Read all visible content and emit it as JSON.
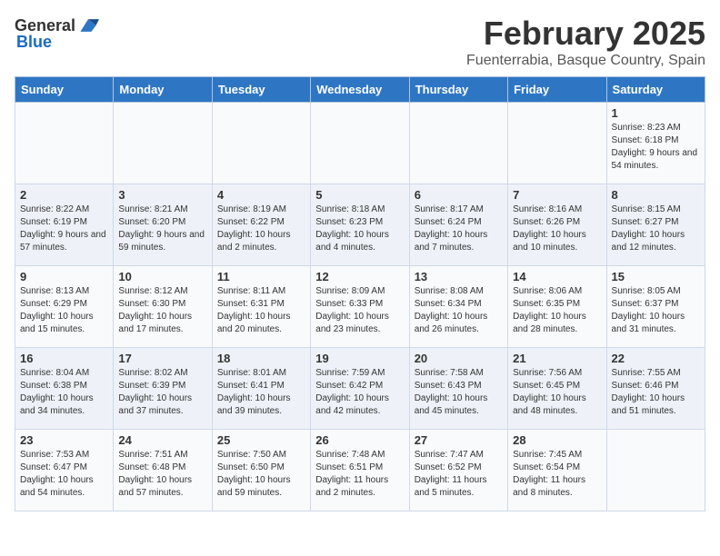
{
  "header": {
    "logo_general": "General",
    "logo_blue": "Blue",
    "title": "February 2025",
    "subtitle": "Fuenterrabia, Basque Country, Spain"
  },
  "calendar": {
    "days_of_week": [
      "Sunday",
      "Monday",
      "Tuesday",
      "Wednesday",
      "Thursday",
      "Friday",
      "Saturday"
    ],
    "weeks": [
      [
        {
          "day": "",
          "info": ""
        },
        {
          "day": "",
          "info": ""
        },
        {
          "day": "",
          "info": ""
        },
        {
          "day": "",
          "info": ""
        },
        {
          "day": "",
          "info": ""
        },
        {
          "day": "",
          "info": ""
        },
        {
          "day": "1",
          "info": "Sunrise: 8:23 AM\nSunset: 6:18 PM\nDaylight: 9 hours and 54 minutes."
        }
      ],
      [
        {
          "day": "2",
          "info": "Sunrise: 8:22 AM\nSunset: 6:19 PM\nDaylight: 9 hours and 57 minutes."
        },
        {
          "day": "3",
          "info": "Sunrise: 8:21 AM\nSunset: 6:20 PM\nDaylight: 9 hours and 59 minutes."
        },
        {
          "day": "4",
          "info": "Sunrise: 8:19 AM\nSunset: 6:22 PM\nDaylight: 10 hours and 2 minutes."
        },
        {
          "day": "5",
          "info": "Sunrise: 8:18 AM\nSunset: 6:23 PM\nDaylight: 10 hours and 4 minutes."
        },
        {
          "day": "6",
          "info": "Sunrise: 8:17 AM\nSunset: 6:24 PM\nDaylight: 10 hours and 7 minutes."
        },
        {
          "day": "7",
          "info": "Sunrise: 8:16 AM\nSunset: 6:26 PM\nDaylight: 10 hours and 10 minutes."
        },
        {
          "day": "8",
          "info": "Sunrise: 8:15 AM\nSunset: 6:27 PM\nDaylight: 10 hours and 12 minutes."
        }
      ],
      [
        {
          "day": "9",
          "info": "Sunrise: 8:13 AM\nSunset: 6:29 PM\nDaylight: 10 hours and 15 minutes."
        },
        {
          "day": "10",
          "info": "Sunrise: 8:12 AM\nSunset: 6:30 PM\nDaylight: 10 hours and 17 minutes."
        },
        {
          "day": "11",
          "info": "Sunrise: 8:11 AM\nSunset: 6:31 PM\nDaylight: 10 hours and 20 minutes."
        },
        {
          "day": "12",
          "info": "Sunrise: 8:09 AM\nSunset: 6:33 PM\nDaylight: 10 hours and 23 minutes."
        },
        {
          "day": "13",
          "info": "Sunrise: 8:08 AM\nSunset: 6:34 PM\nDaylight: 10 hours and 26 minutes."
        },
        {
          "day": "14",
          "info": "Sunrise: 8:06 AM\nSunset: 6:35 PM\nDaylight: 10 hours and 28 minutes."
        },
        {
          "day": "15",
          "info": "Sunrise: 8:05 AM\nSunset: 6:37 PM\nDaylight: 10 hours and 31 minutes."
        }
      ],
      [
        {
          "day": "16",
          "info": "Sunrise: 8:04 AM\nSunset: 6:38 PM\nDaylight: 10 hours and 34 minutes."
        },
        {
          "day": "17",
          "info": "Sunrise: 8:02 AM\nSunset: 6:39 PM\nDaylight: 10 hours and 37 minutes."
        },
        {
          "day": "18",
          "info": "Sunrise: 8:01 AM\nSunset: 6:41 PM\nDaylight: 10 hours and 39 minutes."
        },
        {
          "day": "19",
          "info": "Sunrise: 7:59 AM\nSunset: 6:42 PM\nDaylight: 10 hours and 42 minutes."
        },
        {
          "day": "20",
          "info": "Sunrise: 7:58 AM\nSunset: 6:43 PM\nDaylight: 10 hours and 45 minutes."
        },
        {
          "day": "21",
          "info": "Sunrise: 7:56 AM\nSunset: 6:45 PM\nDaylight: 10 hours and 48 minutes."
        },
        {
          "day": "22",
          "info": "Sunrise: 7:55 AM\nSunset: 6:46 PM\nDaylight: 10 hours and 51 minutes."
        }
      ],
      [
        {
          "day": "23",
          "info": "Sunrise: 7:53 AM\nSunset: 6:47 PM\nDaylight: 10 hours and 54 minutes."
        },
        {
          "day": "24",
          "info": "Sunrise: 7:51 AM\nSunset: 6:48 PM\nDaylight: 10 hours and 57 minutes."
        },
        {
          "day": "25",
          "info": "Sunrise: 7:50 AM\nSunset: 6:50 PM\nDaylight: 10 hours and 59 minutes."
        },
        {
          "day": "26",
          "info": "Sunrise: 7:48 AM\nSunset: 6:51 PM\nDaylight: 11 hours and 2 minutes."
        },
        {
          "day": "27",
          "info": "Sunrise: 7:47 AM\nSunset: 6:52 PM\nDaylight: 11 hours and 5 minutes."
        },
        {
          "day": "28",
          "info": "Sunrise: 7:45 AM\nSunset: 6:54 PM\nDaylight: 11 hours and 8 minutes."
        },
        {
          "day": "",
          "info": ""
        }
      ]
    ]
  }
}
